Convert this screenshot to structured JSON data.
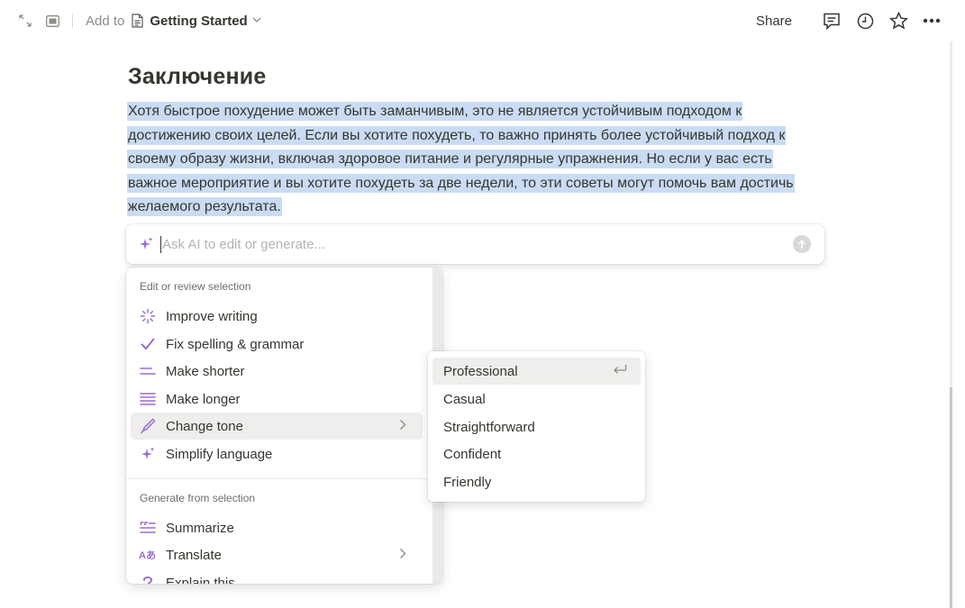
{
  "topbar": {
    "add_to_label": "Add to",
    "page_name": "Getting Started",
    "share_label": "Share",
    "icons": [
      "expand-icon",
      "sidebar-icon",
      "page-doc-icon",
      "comment-icon",
      "clock-icon",
      "star-icon",
      "more-icon"
    ]
  },
  "content": {
    "heading": "Заключение",
    "paragraph": "Хотя быстрое похудение может быть заманчивым, это не является устойчивым подходом к достижению своих целей. Если вы хотите похудеть, то важно принять более устойчивый подход к своему образу жизни, включая здоровое питание и регулярные упражнения. Но если у вас есть важное мероприятие и вы хотите похудеть за две недели, то эти советы могут помочь вам достичь желаемого результата."
  },
  "ai_bar": {
    "placeholder": "Ask AI to edit or generate...",
    "accent_color": "#9b6bd1"
  },
  "menu": {
    "section1": "Edit or review selection",
    "items1": [
      {
        "label": "Improve writing",
        "icon": "sparkle-burst-icon"
      },
      {
        "label": "Fix spelling & grammar",
        "icon": "check-icon"
      },
      {
        "label": "Make shorter",
        "icon": "short-lines-icon"
      },
      {
        "label": "Make longer",
        "icon": "long-lines-icon"
      },
      {
        "label": "Change tone",
        "icon": "pen-icon",
        "has_submenu": true,
        "active": true
      },
      {
        "label": "Simplify language",
        "icon": "sparkle-icon"
      }
    ],
    "section2": "Generate from selection",
    "items2": [
      {
        "label": "Summarize",
        "icon": "summary-icon"
      },
      {
        "label": "Translate",
        "icon": "translate-icon",
        "has_submenu": true
      },
      {
        "label": "Explain this",
        "icon": "question-icon"
      }
    ]
  },
  "submenu": {
    "items": [
      "Professional",
      "Casual",
      "Straightforward",
      "Confident",
      "Friendly"
    ]
  }
}
